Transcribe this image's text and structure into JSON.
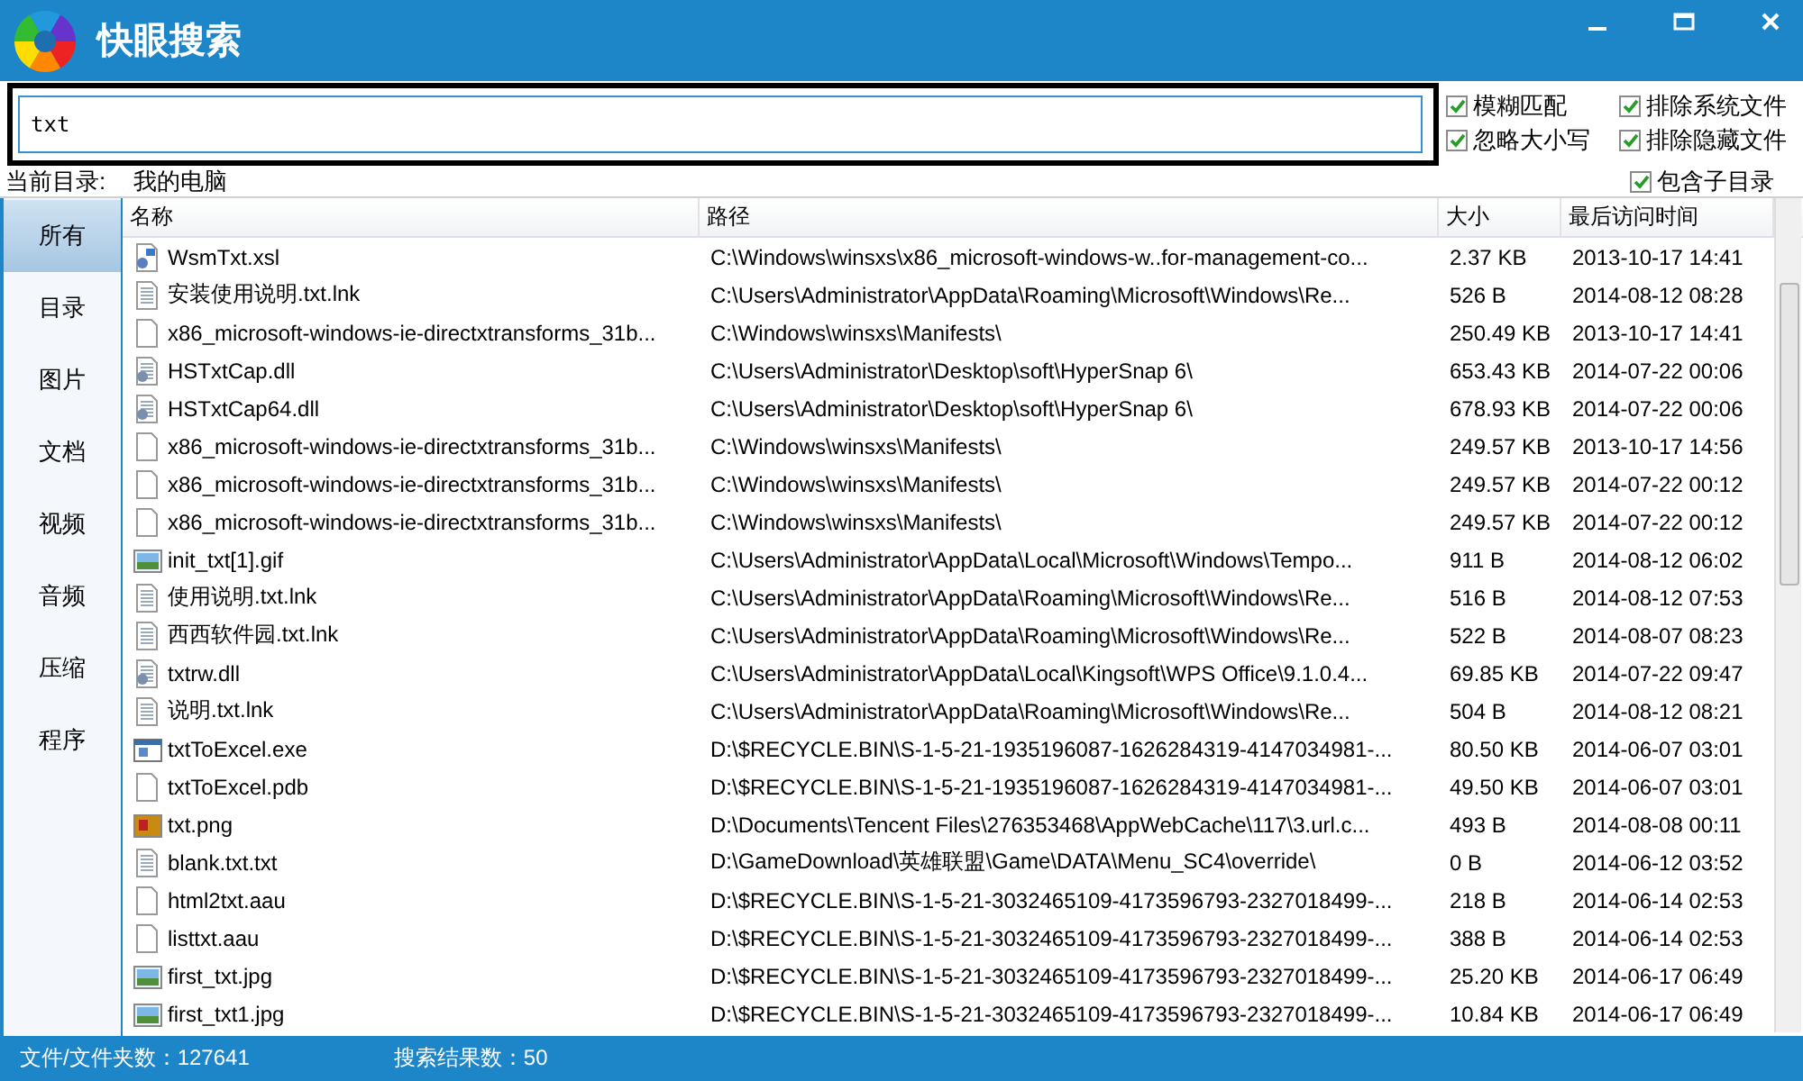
{
  "window": {
    "title": "快眼搜索"
  },
  "search": {
    "value": "txt"
  },
  "options": [
    {
      "label": "模糊匹配",
      "checked": true
    },
    {
      "label": "排除系统文件",
      "checked": true
    },
    {
      "label": "忽略大小写",
      "checked": true
    },
    {
      "label": "排除隐藏文件",
      "checked": true
    }
  ],
  "current_dir": {
    "label": "当前目录:",
    "value": "我的电脑"
  },
  "include_subdirs": {
    "label": "包含子目录",
    "checked": true
  },
  "sidebar": {
    "items": [
      {
        "label": "所有",
        "selected": true
      },
      {
        "label": "目录",
        "selected": false
      },
      {
        "label": "图片",
        "selected": false
      },
      {
        "label": "文档",
        "selected": false
      },
      {
        "label": "视频",
        "selected": false
      },
      {
        "label": "音频",
        "selected": false
      },
      {
        "label": "压缩",
        "selected": false
      },
      {
        "label": "程序",
        "selected": false
      }
    ]
  },
  "table": {
    "columns": [
      "名称",
      "路径",
      "大小",
      "最后访问时间"
    ],
    "rows": [
      {
        "kind": "script",
        "name": "WsmTxt.xsl",
        "path": "C:\\Windows\\winsxs\\x86_microsoft-windows-w..for-management-co...",
        "size": "2.37 KB",
        "time": "2013-10-17 14:41"
      },
      {
        "kind": "text",
        "name": "安装使用说明.txt.lnk",
        "path": "C:\\Users\\Administrator\\AppData\\Roaming\\Microsoft\\Windows\\Re...",
        "size": "526 B",
        "time": "2014-08-12 08:28"
      },
      {
        "kind": "blank",
        "name": "x86_microsoft-windows-ie-directxtransforms_31b...",
        "path": "C:\\Windows\\winsxs\\Manifests\\",
        "size": "250.49 KB",
        "time": "2013-10-17 14:41"
      },
      {
        "kind": "dll",
        "name": "HSTxtCap.dll",
        "path": "C:\\Users\\Administrator\\Desktop\\soft\\HyperSnap 6\\",
        "size": "653.43 KB",
        "time": "2014-07-22 00:06"
      },
      {
        "kind": "dll",
        "name": "HSTxtCap64.dll",
        "path": "C:\\Users\\Administrator\\Desktop\\soft\\HyperSnap 6\\",
        "size": "678.93 KB",
        "time": "2014-07-22 00:06"
      },
      {
        "kind": "blank",
        "name": "x86_microsoft-windows-ie-directxtransforms_31b...",
        "path": "C:\\Windows\\winsxs\\Manifests\\",
        "size": "249.57 KB",
        "time": "2013-10-17 14:56"
      },
      {
        "kind": "blank",
        "name": "x86_microsoft-windows-ie-directxtransforms_31b...",
        "path": "C:\\Windows\\winsxs\\Manifests\\",
        "size": "249.57 KB",
        "time": "2014-07-22 00:12"
      },
      {
        "kind": "blank",
        "name": "x86_microsoft-windows-ie-directxtransforms_31b...",
        "path": "C:\\Windows\\winsxs\\Manifests\\",
        "size": "249.57 KB",
        "time": "2014-07-22 00:12"
      },
      {
        "kind": "image",
        "name": "init_txt[1].gif",
        "path": "C:\\Users\\Administrator\\AppData\\Local\\Microsoft\\Windows\\Tempo...",
        "size": "911 B",
        "time": "2014-08-12 06:02"
      },
      {
        "kind": "text",
        "name": "使用说明.txt.lnk",
        "path": "C:\\Users\\Administrator\\AppData\\Roaming\\Microsoft\\Windows\\Re...",
        "size": "516 B",
        "time": "2014-08-12 07:53"
      },
      {
        "kind": "text",
        "name": "西西软件园.txt.lnk",
        "path": "C:\\Users\\Administrator\\AppData\\Roaming\\Microsoft\\Windows\\Re...",
        "size": "522 B",
        "time": "2014-08-07 08:23"
      },
      {
        "kind": "dll",
        "name": "txtrw.dll",
        "path": "C:\\Users\\Administrator\\AppData\\Local\\Kingsoft\\WPS Office\\9.1.0.4...",
        "size": "69.85 KB",
        "time": "2014-07-22 09:47"
      },
      {
        "kind": "text",
        "name": "说明.txt.lnk",
        "path": "C:\\Users\\Administrator\\AppData\\Roaming\\Microsoft\\Windows\\Re...",
        "size": "504 B",
        "time": "2014-08-12 08:21"
      },
      {
        "kind": "exe",
        "name": "txtToExcel.exe",
        "path": "D:\\$RECYCLE.BIN\\S-1-5-21-1935196087-1626284319-4147034981-...",
        "size": "80.50 KB",
        "time": "2014-06-07 03:01"
      },
      {
        "kind": "blank",
        "name": "txtToExcel.pdb",
        "path": "D:\\$RECYCLE.BIN\\S-1-5-21-1935196087-1626284319-4147034981-...",
        "size": "49.50 KB",
        "time": "2014-06-07 03:01"
      },
      {
        "kind": "png",
        "name": "txt.png",
        "path": "D:\\Documents\\Tencent Files\\276353468\\AppWebCache\\117\\3.url.c...",
        "size": "493 B",
        "time": "2014-08-08 00:11"
      },
      {
        "kind": "text",
        "name": "blank.txt.txt",
        "path": "D:\\GameDownload\\英雄联盟\\Game\\DATA\\Menu_SC4\\override\\",
        "size": "0 B",
        "time": "2014-06-12 03:52"
      },
      {
        "kind": "blank",
        "name": "html2txt.aau",
        "path": "D:\\$RECYCLE.BIN\\S-1-5-21-3032465109-4173596793-2327018499-...",
        "size": "218 B",
        "time": "2014-06-14 02:53"
      },
      {
        "kind": "blank",
        "name": "listtxt.aau",
        "path": "D:\\$RECYCLE.BIN\\S-1-5-21-3032465109-4173596793-2327018499-...",
        "size": "388 B",
        "time": "2014-06-14 02:53"
      },
      {
        "kind": "image",
        "name": "first_txt.jpg",
        "path": "D:\\$RECYCLE.BIN\\S-1-5-21-3032465109-4173596793-2327018499-...",
        "size": "25.20 KB",
        "time": "2014-06-17 06:49"
      },
      {
        "kind": "image",
        "name": "first_txt1.jpg",
        "path": "D:\\$RECYCLE.BIN\\S-1-5-21-3032465109-4173596793-2327018499-...",
        "size": "10.84 KB",
        "time": "2014-06-17 06:49"
      }
    ]
  },
  "status_bar": {
    "file_count": "文件/文件夹数：127641",
    "result_count": "搜索结果数：50"
  }
}
